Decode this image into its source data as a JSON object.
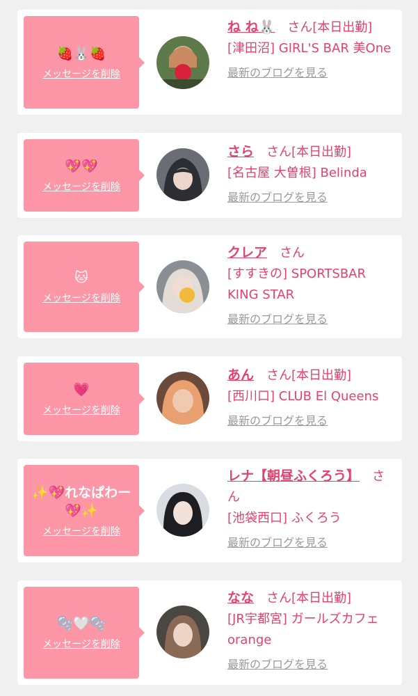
{
  "delete_label": "メッセージを削除",
  "blog_label": "最新のブログを見る",
  "san_label": "さん",
  "cards": [
    {
      "message": "🍓🐰🍓",
      "name": "ね ね🐰",
      "suffix": "[本日出勤]",
      "location": "[津田沼] GIRL'S BAR 美One"
    },
    {
      "message": "💖💖",
      "name": "さら",
      "suffix": "[本日出勤]",
      "location": "[名古屋 大曽根] Belinda"
    },
    {
      "message": "🐱",
      "name": "クレア",
      "suffix": "",
      "location": "[すすきの] SPORTSBAR KING STAR"
    },
    {
      "message": "💗",
      "name": "あん",
      "suffix": "[本日出勤]",
      "location": "[西川口] CLUB El Queens"
    },
    {
      "message": "✨💖れなぱわー💖✨",
      "name": "レナ【朝昼ふくろう】",
      "suffix": "",
      "location": "[池袋西口] ふくろう"
    },
    {
      "message": "🫧🤍🫧",
      "name": "なな",
      "suffix": "[本日出勤]",
      "location": "[JR宇都宮] ガールズカフェ orange"
    }
  ],
  "colors": {
    "bubble": "#fd97a8",
    "accent": "#e2436d",
    "muted": "#9a9a9a"
  }
}
